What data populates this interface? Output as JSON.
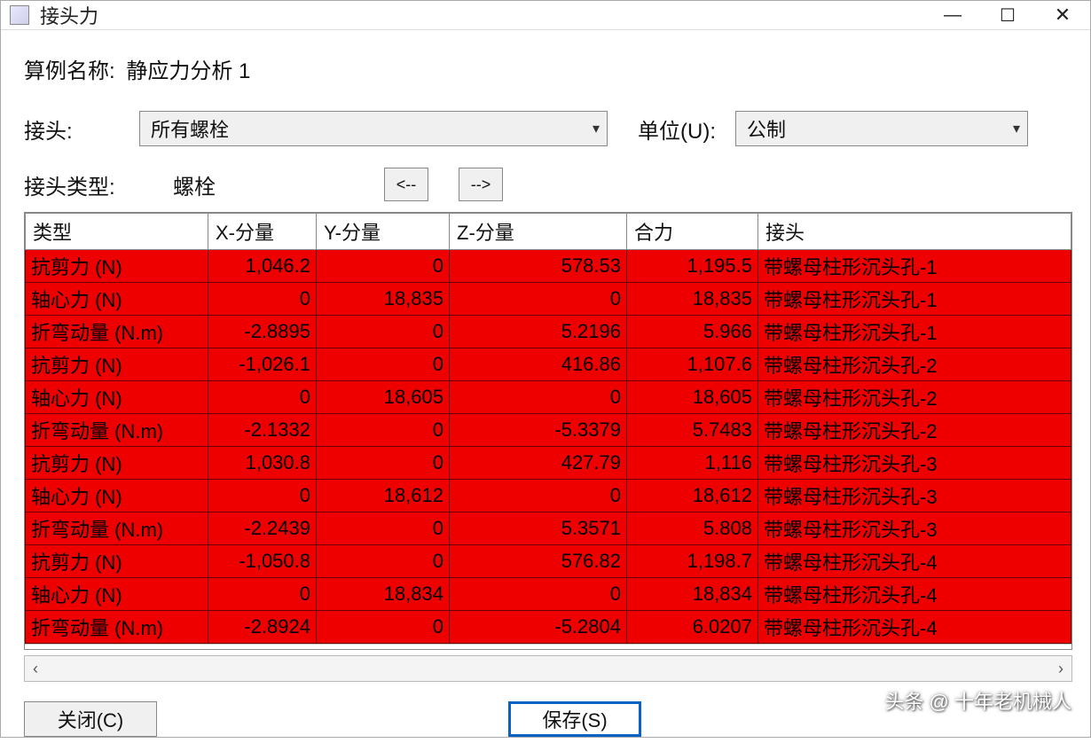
{
  "window": {
    "title": "接头力",
    "minimize": "—",
    "maximize": "☐",
    "close": "✕"
  },
  "study": {
    "label": "算例名称:",
    "value": "静应力分析 1"
  },
  "filters": {
    "connector_label": "接头:",
    "connector_value": "所有螺栓",
    "unit_label": "单位(U):",
    "unit_value": "公制"
  },
  "type_row": {
    "label": "接头类型:",
    "value": "螺栓",
    "prev": "<--",
    "next": "-->"
  },
  "table": {
    "headers": [
      "类型",
      "X-分量",
      "Y-分量",
      "Z-分量",
      "合力",
      "接头"
    ],
    "rows": [
      {
        "type": "抗剪力 (N)",
        "x": "1,046.2",
        "y": "0",
        "z": "578.53",
        "res": "1,195.5",
        "conn": "带螺母柱形沉头孔-1"
      },
      {
        "type": "轴心力 (N)",
        "x": "0",
        "y": "18,835",
        "z": "0",
        "res": "18,835",
        "conn": "带螺母柱形沉头孔-1"
      },
      {
        "type": "折弯动量 (N.m)",
        "x": "-2.8895",
        "y": "0",
        "z": "5.2196",
        "res": "5.966",
        "conn": "带螺母柱形沉头孔-1"
      },
      {
        "type": "抗剪力 (N)",
        "x": "-1,026.1",
        "y": "0",
        "z": "416.86",
        "res": "1,107.6",
        "conn": "带螺母柱形沉头孔-2"
      },
      {
        "type": "轴心力 (N)",
        "x": "0",
        "y": "18,605",
        "z": "0",
        "res": "18,605",
        "conn": "带螺母柱形沉头孔-2"
      },
      {
        "type": "折弯动量 (N.m)",
        "x": "-2.1332",
        "y": "0",
        "z": "-5.3379",
        "res": "5.7483",
        "conn": "带螺母柱形沉头孔-2"
      },
      {
        "type": "抗剪力 (N)",
        "x": "1,030.8",
        "y": "0",
        "z": "427.79",
        "res": "1,116",
        "conn": "带螺母柱形沉头孔-3"
      },
      {
        "type": "轴心力 (N)",
        "x": "0",
        "y": "18,612",
        "z": "0",
        "res": "18,612",
        "conn": "带螺母柱形沉头孔-3"
      },
      {
        "type": "折弯动量 (N.m)",
        "x": "-2.2439",
        "y": "0",
        "z": "5.3571",
        "res": "5.808",
        "conn": "带螺母柱形沉头孔-3"
      },
      {
        "type": "抗剪力 (N)",
        "x": "-1,050.8",
        "y": "0",
        "z": "576.82",
        "res": "1,198.7",
        "conn": "带螺母柱形沉头孔-4"
      },
      {
        "type": "轴心力 (N)",
        "x": "0",
        "y": "18,834",
        "z": "0",
        "res": "18,834",
        "conn": "带螺母柱形沉头孔-4"
      },
      {
        "type": "折弯动量 (N.m)",
        "x": "-2.8924",
        "y": "0",
        "z": "-5.2804",
        "res": "6.0207",
        "conn": "带螺母柱形沉头孔-4"
      }
    ]
  },
  "footer": {
    "close": "关闭(C)",
    "save": "保存(S)"
  },
  "watermark": "头条 @ 十年老机械人"
}
